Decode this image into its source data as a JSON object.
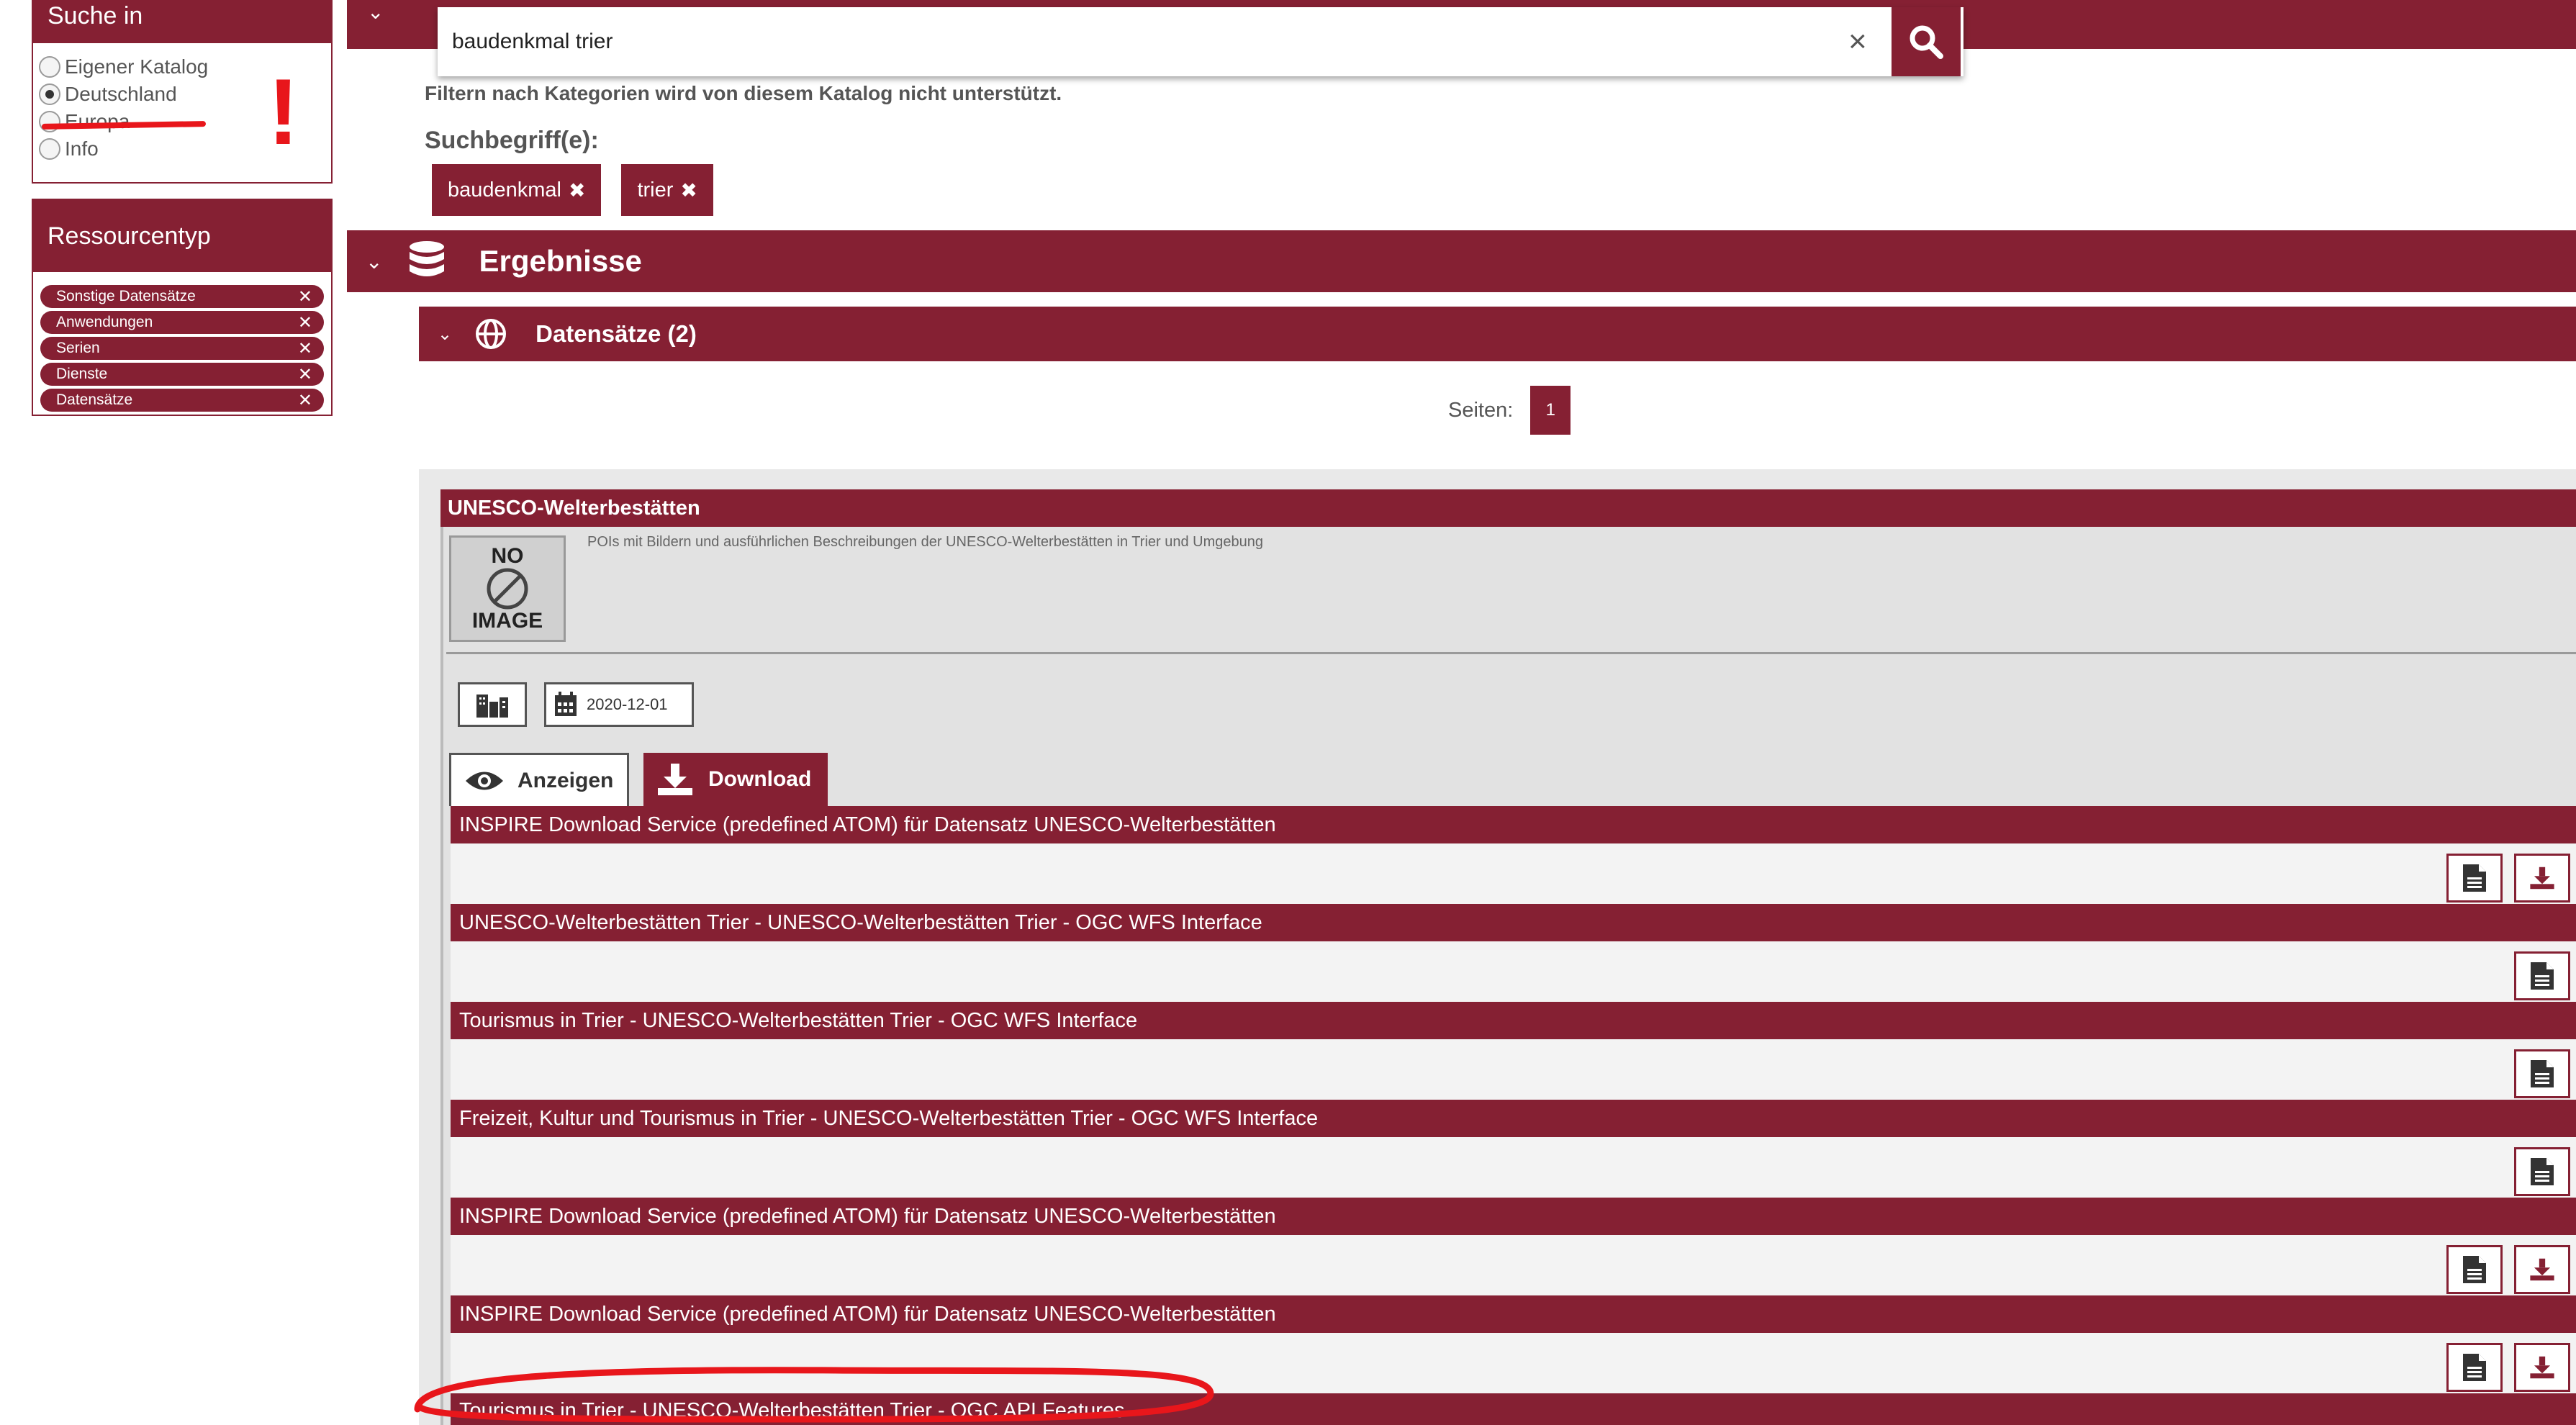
{
  "search": {
    "value": "baudenkmal trier",
    "clear_label": "×"
  },
  "sidebar": {
    "search_in": {
      "title": "Suche in",
      "options": [
        "Eigener Katalog",
        "Deutschland",
        "Europa",
        "Info"
      ],
      "selected": "Deutschland"
    },
    "resource_type": {
      "title": "Ressourcentyp",
      "filters": [
        "Sonstige Datensätze",
        "Anwendungen",
        "Serien",
        "Dienste",
        "Datensätze"
      ]
    }
  },
  "main": {
    "filter_note": "Filtern nach Kategorien wird von diesem Katalog nicht unterstützt.",
    "terms_label": "Suchbegriff(e):",
    "terms": [
      "baudenkmal",
      "trier"
    ],
    "results_title": "Ergebnisse",
    "datasets_title": "Datensätze (2)",
    "pages_label": "Seiten:",
    "current_page": "1"
  },
  "result": {
    "title": "UNESCO-Welterbestätten",
    "description": "POIs mit Bildern und ausführlichen Beschreibungen der UNESCO-Welterbestätten in Trier und Umgebung",
    "no_image_top": "NO",
    "no_image_bottom": "IMAGE",
    "date": "2020-12-01",
    "tabs": {
      "show": "Anzeigen",
      "download": "Download"
    },
    "services": [
      {
        "title": "INSPIRE Download Service (predefined ATOM) für Datensatz UNESCO-Welterbestätten",
        "buttons": [
          "doc",
          "download"
        ]
      },
      {
        "title": "UNESCO-Welterbestätten Trier - UNESCO-Welterbestätten Trier - OGC WFS Interface",
        "buttons": [
          "doc"
        ]
      },
      {
        "title": "Tourismus in Trier - UNESCO-Welterbestätten Trier - OGC WFS Interface",
        "buttons": [
          "doc"
        ]
      },
      {
        "title": "Freizeit, Kultur und Tourismus in Trier - UNESCO-Welterbestätten Trier - OGC WFS Interface",
        "buttons": [
          "doc"
        ]
      },
      {
        "title": "INSPIRE Download Service (predefined ATOM) für Datensatz UNESCO-Welterbestätten",
        "buttons": [
          "doc",
          "download"
        ]
      },
      {
        "title": "INSPIRE Download Service (predefined ATOM) für Datensatz UNESCO-Welterbestätten",
        "buttons": [
          "doc",
          "download"
        ]
      },
      {
        "title": "Tourismus in Trier - UNESCO-Welterbestätten Trier - OGC API Features",
        "buttons": []
      }
    ]
  },
  "annotations": {
    "exclamation": "!"
  },
  "colors": {
    "accent": "#852033",
    "annotation": "#e8161b"
  }
}
